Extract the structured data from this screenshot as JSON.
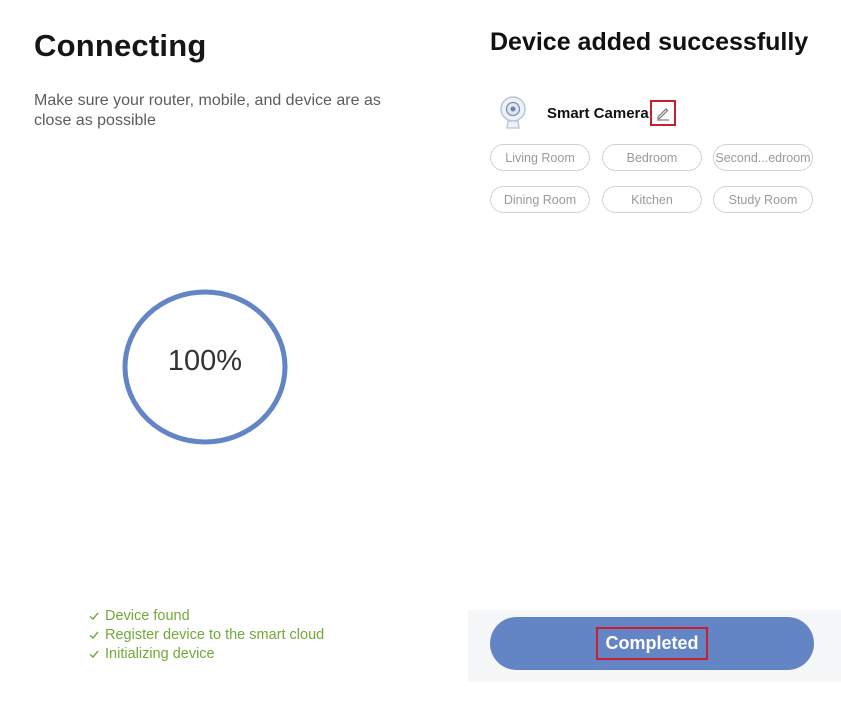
{
  "left": {
    "title": "Connecting",
    "subtitle": "Make sure your router, mobile, and device are as close as possible",
    "progress": {
      "value_text": "100%",
      "fraction": 1.0
    },
    "steps": [
      "Device found",
      "Register device to the smart cloud",
      "Initializing device"
    ]
  },
  "right": {
    "title": "Device added successfully",
    "device_name": "Smart Camera",
    "rooms": [
      "Living Room",
      "Bedroom",
      "Second...edroom",
      "Dining Room",
      "Kitchen",
      "Study Room"
    ],
    "completed_label": "Completed"
  },
  "icons": {
    "device": "camera-icon",
    "edit": "pencil-icon",
    "step": "check-icon"
  },
  "colors": {
    "accent": "#6384c5",
    "success": "#71a93a",
    "highlight": "#c8202d"
  }
}
